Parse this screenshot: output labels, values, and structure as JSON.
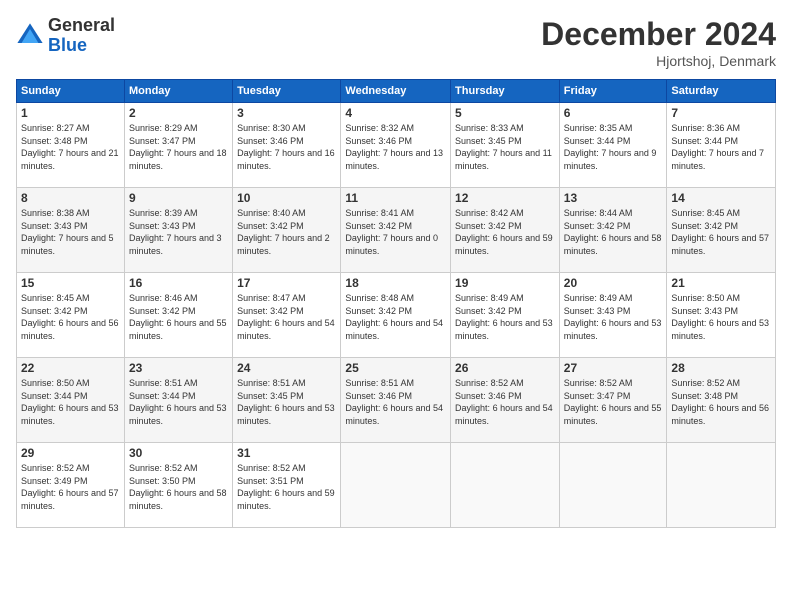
{
  "logo": {
    "general": "General",
    "blue": "Blue"
  },
  "header": {
    "month": "December 2024",
    "location": "Hjortshoj, Denmark"
  },
  "days_of_week": [
    "Sunday",
    "Monday",
    "Tuesday",
    "Wednesday",
    "Thursday",
    "Friday",
    "Saturday"
  ],
  "weeks": [
    [
      {
        "day": "1",
        "sunrise": "8:27 AM",
        "sunset": "3:48 PM",
        "daylight": "7 hours and 21 minutes."
      },
      {
        "day": "2",
        "sunrise": "8:29 AM",
        "sunset": "3:47 PM",
        "daylight": "7 hours and 18 minutes."
      },
      {
        "day": "3",
        "sunrise": "8:30 AM",
        "sunset": "3:46 PM",
        "daylight": "7 hours and 16 minutes."
      },
      {
        "day": "4",
        "sunrise": "8:32 AM",
        "sunset": "3:46 PM",
        "daylight": "7 hours and 13 minutes."
      },
      {
        "day": "5",
        "sunrise": "8:33 AM",
        "sunset": "3:45 PM",
        "daylight": "7 hours and 11 minutes."
      },
      {
        "day": "6",
        "sunrise": "8:35 AM",
        "sunset": "3:44 PM",
        "daylight": "7 hours and 9 minutes."
      },
      {
        "day": "7",
        "sunrise": "8:36 AM",
        "sunset": "3:44 PM",
        "daylight": "7 hours and 7 minutes."
      }
    ],
    [
      {
        "day": "8",
        "sunrise": "8:38 AM",
        "sunset": "3:43 PM",
        "daylight": "7 hours and 5 minutes."
      },
      {
        "day": "9",
        "sunrise": "8:39 AM",
        "sunset": "3:43 PM",
        "daylight": "7 hours and 3 minutes."
      },
      {
        "day": "10",
        "sunrise": "8:40 AM",
        "sunset": "3:42 PM",
        "daylight": "7 hours and 2 minutes."
      },
      {
        "day": "11",
        "sunrise": "8:41 AM",
        "sunset": "3:42 PM",
        "daylight": "7 hours and 0 minutes."
      },
      {
        "day": "12",
        "sunrise": "8:42 AM",
        "sunset": "3:42 PM",
        "daylight": "6 hours and 59 minutes."
      },
      {
        "day": "13",
        "sunrise": "8:44 AM",
        "sunset": "3:42 PM",
        "daylight": "6 hours and 58 minutes."
      },
      {
        "day": "14",
        "sunrise": "8:45 AM",
        "sunset": "3:42 PM",
        "daylight": "6 hours and 57 minutes."
      }
    ],
    [
      {
        "day": "15",
        "sunrise": "8:45 AM",
        "sunset": "3:42 PM",
        "daylight": "6 hours and 56 minutes."
      },
      {
        "day": "16",
        "sunrise": "8:46 AM",
        "sunset": "3:42 PM",
        "daylight": "6 hours and 55 minutes."
      },
      {
        "day": "17",
        "sunrise": "8:47 AM",
        "sunset": "3:42 PM",
        "daylight": "6 hours and 54 minutes."
      },
      {
        "day": "18",
        "sunrise": "8:48 AM",
        "sunset": "3:42 PM",
        "daylight": "6 hours and 54 minutes."
      },
      {
        "day": "19",
        "sunrise": "8:49 AM",
        "sunset": "3:42 PM",
        "daylight": "6 hours and 53 minutes."
      },
      {
        "day": "20",
        "sunrise": "8:49 AM",
        "sunset": "3:43 PM",
        "daylight": "6 hours and 53 minutes."
      },
      {
        "day": "21",
        "sunrise": "8:50 AM",
        "sunset": "3:43 PM",
        "daylight": "6 hours and 53 minutes."
      }
    ],
    [
      {
        "day": "22",
        "sunrise": "8:50 AM",
        "sunset": "3:44 PM",
        "daylight": "6 hours and 53 minutes."
      },
      {
        "day": "23",
        "sunrise": "8:51 AM",
        "sunset": "3:44 PM",
        "daylight": "6 hours and 53 minutes."
      },
      {
        "day": "24",
        "sunrise": "8:51 AM",
        "sunset": "3:45 PM",
        "daylight": "6 hours and 53 minutes."
      },
      {
        "day": "25",
        "sunrise": "8:51 AM",
        "sunset": "3:46 PM",
        "daylight": "6 hours and 54 minutes."
      },
      {
        "day": "26",
        "sunrise": "8:52 AM",
        "sunset": "3:46 PM",
        "daylight": "6 hours and 54 minutes."
      },
      {
        "day": "27",
        "sunrise": "8:52 AM",
        "sunset": "3:47 PM",
        "daylight": "6 hours and 55 minutes."
      },
      {
        "day": "28",
        "sunrise": "8:52 AM",
        "sunset": "3:48 PM",
        "daylight": "6 hours and 56 minutes."
      }
    ],
    [
      {
        "day": "29",
        "sunrise": "8:52 AM",
        "sunset": "3:49 PM",
        "daylight": "6 hours and 57 minutes."
      },
      {
        "day": "30",
        "sunrise": "8:52 AM",
        "sunset": "3:50 PM",
        "daylight": "6 hours and 58 minutes."
      },
      {
        "day": "31",
        "sunrise": "8:52 AM",
        "sunset": "3:51 PM",
        "daylight": "6 hours and 59 minutes."
      },
      null,
      null,
      null,
      null
    ]
  ]
}
